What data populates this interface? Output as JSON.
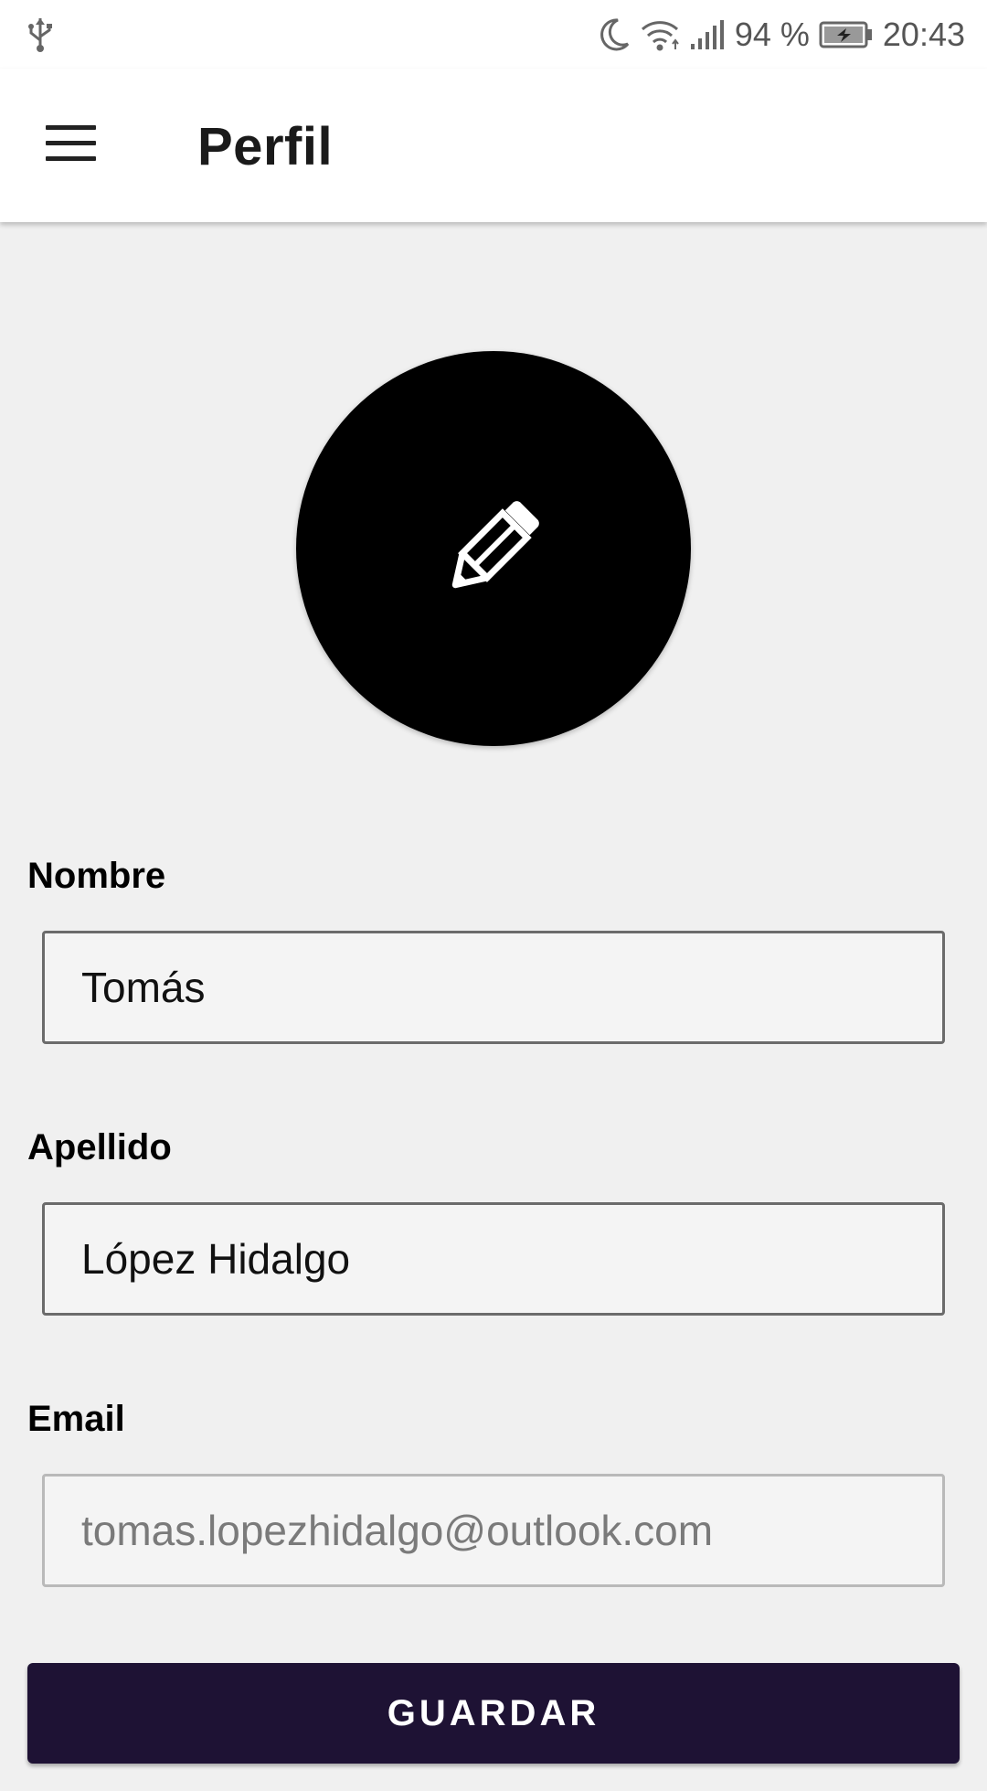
{
  "status_bar": {
    "battery_percent": "94 %",
    "time": "20:43",
    "icons": [
      "usb-icon",
      "moon-icon",
      "wifi-icon",
      "signal-icon",
      "battery-charging-icon"
    ]
  },
  "app_bar": {
    "title": "Perfil",
    "menu_icon": "hamburger-menu-icon"
  },
  "avatar": {
    "icon": "pencil-icon"
  },
  "form": {
    "nombre": {
      "label": "Nombre",
      "value": "Tomás"
    },
    "apellido": {
      "label": "Apellido",
      "value": "López Hidalgo"
    },
    "email": {
      "label": "Email",
      "value": "tomas.lopezhidalgo@outlook.com"
    }
  },
  "save_button": {
    "label": "GUARDAR"
  },
  "colors": {
    "background": "#f0f0f0",
    "app_bar": "#ffffff",
    "avatar": "#000000",
    "button": "#1e1234",
    "button_text": "#ffffff"
  }
}
